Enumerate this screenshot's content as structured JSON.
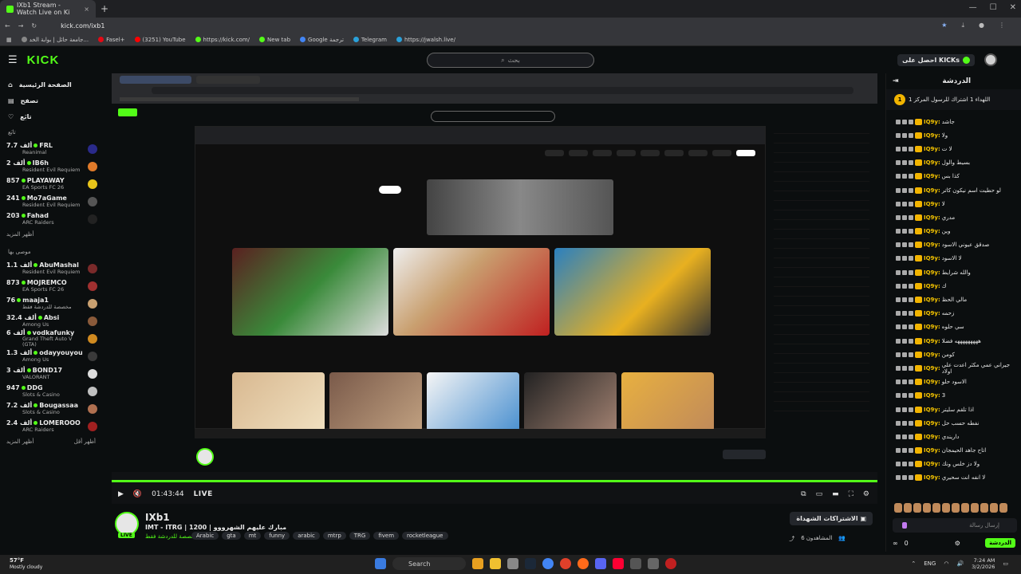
{
  "browser": {
    "tabs": [
      {
        "title": "IXb1 Stream - Watch Live on Ki",
        "active": true
      }
    ],
    "url": "kick.com/ixb1",
    "bookmarks": [
      "جامعة حائل | بوابة الخد...",
      "Fasel+",
      "(3251) YouTube",
      "https://kick.com/",
      "New tab",
      "Google ترجمة",
      "Telegram",
      "https://jwalsh.live/"
    ]
  },
  "header": {
    "logo": "KICK",
    "search_placeholder": "بحث",
    "kicks_label": "احصل على KICKs"
  },
  "sidebar": {
    "nav": [
      {
        "label": "الصفحة الرئيسية",
        "icon": "home-icon"
      },
      {
        "label": "تصفح",
        "icon": "browse-icon"
      },
      {
        "label": "تابَع",
        "icon": "heart-icon"
      }
    ],
    "following_title": "تابَع",
    "following": [
      {
        "name": "FRL",
        "viewers": "7.7 ألف",
        "game": "Reanimal"
      },
      {
        "name": "IB6h",
        "viewers": "2 ألف",
        "game": "Resident Evil Requiem"
      },
      {
        "name": "PLAYAWAY",
        "viewers": "857",
        "game": "EA Sports FC 26"
      },
      {
        "name": "Mo7aGame",
        "viewers": "241",
        "game": "Resident Evil Requiem"
      },
      {
        "name": "Fahad",
        "viewers": "203",
        "game": "ARC Raiders"
      }
    ],
    "show_more": "أظهر المزيد",
    "recommended_title": "موصى بها",
    "recommended": [
      {
        "name": "AbuMashal",
        "viewers": "1.1 ألف",
        "game": "Resident Evil Requiem"
      },
      {
        "name": "MOJREMCO",
        "viewers": "873",
        "game": "EA Sports FC 26"
      },
      {
        "name": "maaja1",
        "viewers": "76",
        "game": "مخصصة للدردشة فقط"
      },
      {
        "name": "Absi",
        "viewers": "32.4 ألف",
        "game": "Among Us"
      },
      {
        "name": "vodkafunky",
        "viewers": "6 ألف",
        "game": "Grand Theft Auto V (GTA)"
      },
      {
        "name": "odayyouyou",
        "viewers": "1.3 ألف",
        "game": "Among Us"
      },
      {
        "name": "BOND17",
        "viewers": "3 ألف",
        "game": "VALORANT"
      },
      {
        "name": "DDG",
        "viewers": "947",
        "game": "Slots & Casino"
      },
      {
        "name": "Bougassaa",
        "viewers": "7.2 ألف",
        "game": "Slots & Casino"
      },
      {
        "name": "LOMEROOO",
        "viewers": "2.4 ألف",
        "game": "ARC Raiders"
      }
    ],
    "show_more2": "أظهر المزيد",
    "show_less": "أظهر أقل"
  },
  "player": {
    "time": "01:43:44",
    "live_label": "LIVE"
  },
  "stream": {
    "name": "IXb1",
    "title": "IMT - ITRG | 1200 | مبارك عليهم الشهرووو",
    "category": "مخصصة للدردشة فقط",
    "tags": [
      "Arabic",
      "gta",
      "mt",
      "funny",
      "arabic",
      "mtrp",
      "TRG",
      "fivem",
      "rocketleague"
    ],
    "subscribe_label": "الاشتراكات الشهداة",
    "viewers_label": "المشاهدون 6"
  },
  "chat": {
    "title": "الدردشة",
    "pinned_text": "اللهداء 1 اشتراك للرسول المركز 1",
    "pinned_count": "1",
    "messages": [
      {
        "user": "IQ9y:",
        "text": "جاشد"
      },
      {
        "user": "IQ9y:",
        "text": "ولا"
      },
      {
        "user": "IQ9y:",
        "text": "لا ت"
      },
      {
        "user": "IQ9y:",
        "text": "بسيط والول"
      },
      {
        "user": "IQ9y:",
        "text": "كذا بس"
      },
      {
        "user": "IQ9y:",
        "text": "لو حطيت اسم نيكون كاتر"
      },
      {
        "user": "IQ9y:",
        "text": "لا"
      },
      {
        "user": "IQ9y:",
        "text": "مدري"
      },
      {
        "user": "IQ9y:",
        "text": "وين"
      },
      {
        "user": "IQ9y:",
        "text": "صدقق عيوني الاسود"
      },
      {
        "user": "IQ9y:",
        "text": "لا الاسود"
      },
      {
        "user": "IQ9y:",
        "text": "والله شرايط"
      },
      {
        "user": "IQ9y:",
        "text": "ك"
      },
      {
        "user": "IQ9y:",
        "text": "مالي الحظ"
      },
      {
        "user": "IQ9y:",
        "text": "زحمه"
      },
      {
        "user": "IQ9y:",
        "text": "سي حلوه"
      },
      {
        "user": "IQ9y:",
        "text": "هههههههههه فضلا"
      },
      {
        "user": "IQ9y:",
        "text": "كومن"
      },
      {
        "user": "IQ9y:",
        "text": "جيراني عمي مكثر اعدت علي اولاد"
      },
      {
        "user": "IQ9y:",
        "text": "الاسود حلو"
      },
      {
        "user": "IQ9y:",
        "text": "3"
      },
      {
        "user": "IQ9y:",
        "text": "اذا تلقم سليتر"
      },
      {
        "user": "IQ9y:",
        "text": "نفطه حسب حل"
      },
      {
        "user": "IQ9y:",
        "text": "داريندي"
      },
      {
        "user": "IQ9y:",
        "text": "اتاح جاهد الحيمجان"
      },
      {
        "user": "IQ9y:",
        "text": "ولا دز خلس ونك"
      },
      {
        "user": "IQ9y:",
        "text": "لا انفه انت سحيري"
      }
    ],
    "input_placeholder": "إرسال رسالة",
    "kicks_count": "0",
    "send_label": "الدردشة"
  },
  "taskbar": {
    "weather_temp": "57°F",
    "weather_desc": "Mostly cloudy",
    "search_label": "Search",
    "lang": "ENG",
    "time": "7:24 AM",
    "date": "3/2/2026"
  },
  "colors": {
    "accent": "#53fc18",
    "gold": "#f2b400",
    "bg": "#0b0e0f"
  }
}
